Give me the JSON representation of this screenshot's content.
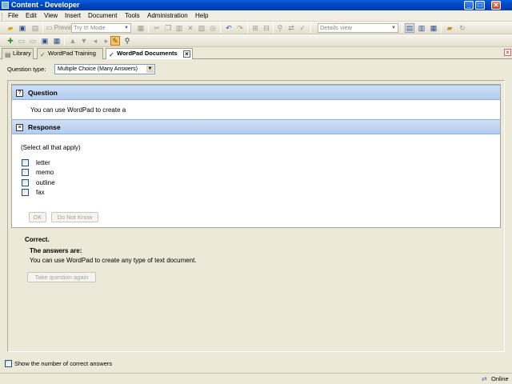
{
  "window": {
    "title": "Content - Developer",
    "controls": {
      "minimize": "_",
      "maximize": "□",
      "close": "✕"
    }
  },
  "menu": [
    "File",
    "Edit",
    "View",
    "Insert",
    "Document",
    "Tools",
    "Administration",
    "Help"
  ],
  "toolbar": {
    "preview_label": "Preview",
    "mode_select": "Try It! Mode",
    "view_select": "Details view"
  },
  "tabs": [
    {
      "label": "Library",
      "icon": "library-icon"
    },
    {
      "label": "WordPad Training",
      "icon": "outline-icon"
    },
    {
      "label": "WordPad Documents",
      "icon": "question-icon",
      "active": true
    }
  ],
  "question_type": {
    "label": "Question type:",
    "value": "Multiple Choice (Many Answers)"
  },
  "question": {
    "header": "Question",
    "text": "You can use WordPad to create a"
  },
  "response": {
    "header": "Response",
    "instruction": "(Select all that apply)",
    "options": [
      {
        "label": "letter",
        "checked": false
      },
      {
        "label": "memo",
        "checked": false
      },
      {
        "label": "outline",
        "checked": false
      },
      {
        "label": "fax",
        "checked": false
      }
    ],
    "ok_button": "OK",
    "dont_know_button": "Do Not Know"
  },
  "feedback": {
    "result": "Correct.",
    "answers_label": "The answers are:",
    "answers_text": "You can use WordPad to create any type of text document.",
    "retry_button": "Take question again"
  },
  "show_correct": {
    "label": "Show the number of correct answers",
    "checked": false
  },
  "status": {
    "text": "Online"
  }
}
